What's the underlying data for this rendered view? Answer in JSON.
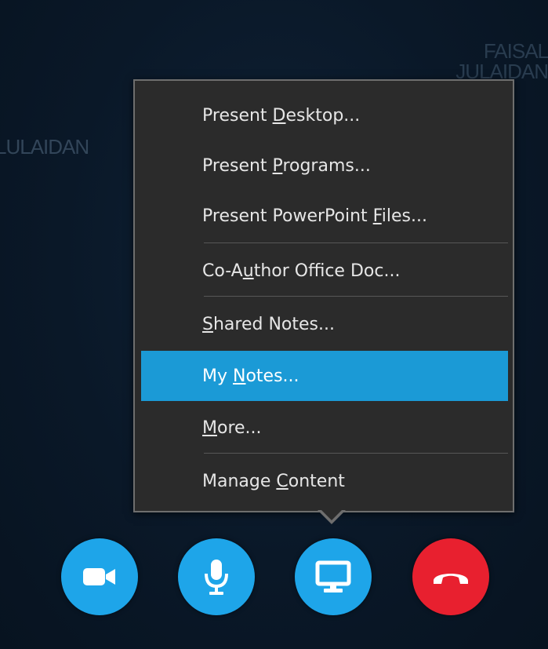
{
  "background": {
    "participant_name_left": "LULAIDAN",
    "participant_name_right": "FAISAL JULAIDAN"
  },
  "menu": {
    "items": [
      {
        "prefix": "Present ",
        "mnemonic": "D",
        "suffix": "esktop..."
      },
      {
        "prefix": "Present ",
        "mnemonic": "P",
        "suffix": "rograms..."
      },
      {
        "prefix": "Present PowerPoint ",
        "mnemonic": "F",
        "suffix": "iles..."
      },
      {
        "prefix": "Co-A",
        "mnemonic": "u",
        "suffix": "thor Office Doc..."
      },
      {
        "prefix": "",
        "mnemonic": "S",
        "suffix": "hared Notes..."
      },
      {
        "prefix": "My ",
        "mnemonic": "N",
        "suffix": "otes..."
      },
      {
        "prefix": "",
        "mnemonic": "M",
        "suffix": "ore..."
      },
      {
        "prefix": "Manage ",
        "mnemonic": "C",
        "suffix": "ontent"
      }
    ],
    "highlighted_item": "My Notes..."
  },
  "controls": {
    "video_icon": "video-camera-icon",
    "mic_icon": "microphone-icon",
    "present_icon": "monitor-icon",
    "hangup_icon": "phone-hangup-icon"
  },
  "colors": {
    "accent": "#1ea5e9",
    "highlight": "#1b9ad6",
    "hangup": "#e8202f",
    "menu_bg": "#2b2b2b"
  }
}
